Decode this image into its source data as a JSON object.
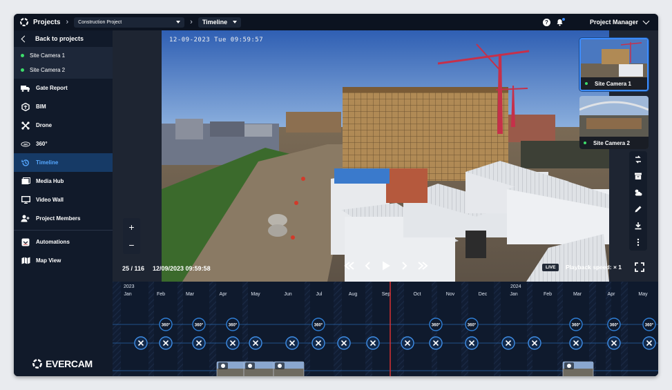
{
  "topbar": {
    "projects_label": "Projects",
    "project_select": "Construction Project",
    "view_select": "Timeline",
    "help_label": "?",
    "user_label": "Project Manager"
  },
  "sidebar": {
    "back_label": "Back to projects",
    "cameras": [
      {
        "label": "Site Camera 1",
        "status_color": "#3ddc6b"
      },
      {
        "label": "Site Camera 2",
        "status_color": "#3ddc6b"
      }
    ],
    "items": [
      {
        "label": "Gate Report",
        "icon": "truck-icon"
      },
      {
        "label": "BIM",
        "icon": "bim-icon"
      },
      {
        "label": "Drone",
        "icon": "drone-icon"
      },
      {
        "label": "360°",
        "icon": "360-icon"
      },
      {
        "label": "Timeline",
        "icon": "history-icon",
        "active": true
      },
      {
        "label": "Media Hub",
        "icon": "media-hub-icon"
      },
      {
        "label": "Video Wall",
        "icon": "monitor-icon"
      },
      {
        "label": "Project Members",
        "icon": "add-user-icon"
      },
      {
        "label": "Automations",
        "icon": "automation-icon"
      },
      {
        "label": "Map View",
        "icon": "map-icon"
      }
    ],
    "brand": "EVERCAM"
  },
  "viewer": {
    "timestamp_overlay": "12-09-2023 Tue 09:59:57",
    "frame_counter": "25 / 116",
    "frame_datetime": "12/09/2023 09:59:58",
    "live_label": "LIVE",
    "playback_speed": "Playback speed: × 1",
    "zoom_in": "+",
    "zoom_out": "−",
    "thumbnails": [
      {
        "label": "Site Camera 1",
        "selected": true
      },
      {
        "label": "Site Camera 2",
        "selected": false
      }
    ],
    "tools": [
      "compare-icon",
      "archive-icon",
      "weather-icon",
      "edit-icon",
      "download-icon",
      "more-icon"
    ]
  },
  "timeline": {
    "years": [
      "2023",
      "2024"
    ],
    "months": [
      "Jan",
      "Feb",
      "Mar",
      "Apr",
      "May",
      "Jun",
      "Jul",
      "Aug",
      "Sep",
      "Oct",
      "Nov",
      "Dec",
      "Jan",
      "Feb",
      "Mar",
      "Apr",
      "May"
    ],
    "accent": "#2f7fd6",
    "cursor_color": "#e63333",
    "badge_360_label": "360°"
  }
}
